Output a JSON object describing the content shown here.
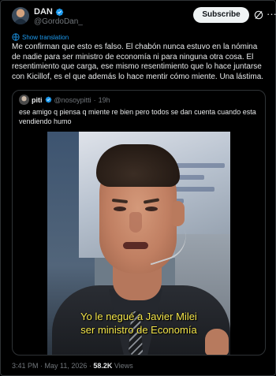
{
  "author": {
    "display_name": "DAN",
    "handle": "@GordoDan_"
  },
  "header": {
    "subscribe_label": "Subscribe",
    "grok_icon": "grok-icon",
    "more_label": "···"
  },
  "translation": {
    "label": "Show translation"
  },
  "tweet": {
    "text": "Me confirman que esto es falso. El chabón nunca estuvo en la nómina de nadie para ser ministro de economía ni para ninguna otra cosa. El resentimiento que carga, ese mismo resentimiento que lo hace juntarse con Kicillof, es el que además lo hace mentir cómo miente. Una lástima."
  },
  "quote": {
    "display_name": "piti",
    "handle": "@nosoypitti",
    "separator": "·",
    "time": "19h",
    "text": "ese amigo q piensa q miente re bien pero todos se dan cuenta cuando esta vendiendo humo",
    "video_caption_line1": "Yo le negué a Javier Milei",
    "video_caption_line2": "ser ministro de Economía"
  },
  "footer": {
    "timestamp": "3:41 PM · May 11, 2026 · ",
    "views_count": "58.2K",
    "views_label": " Views"
  },
  "colors": {
    "background": "#000000",
    "text": "#e7e9ea",
    "muted": "#71767b",
    "accent": "#1d9bf0",
    "caption": "#f4e64a"
  }
}
